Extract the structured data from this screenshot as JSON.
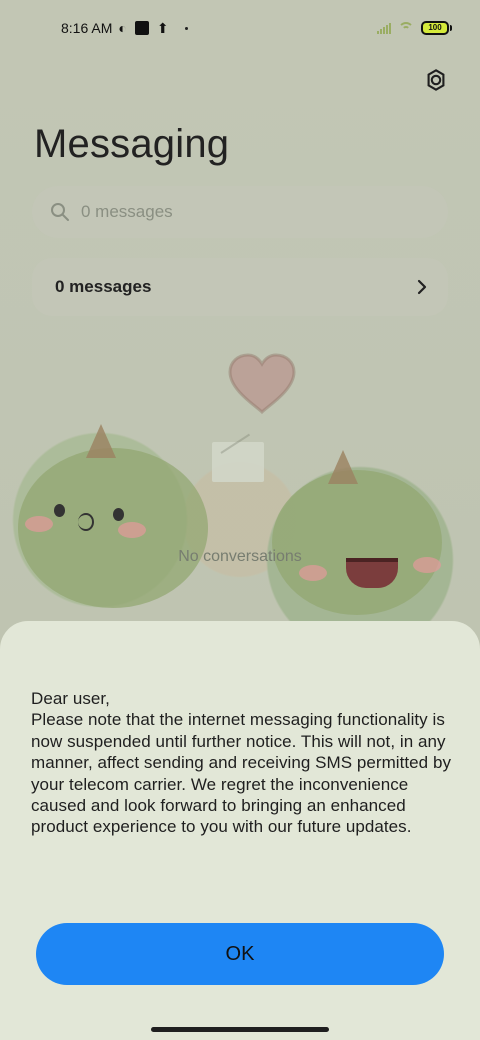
{
  "status_bar": {
    "time": "8:16 AM",
    "battery": "100"
  },
  "header": {
    "title": "Messaging"
  },
  "search": {
    "placeholder": "0 messages"
  },
  "messages_row": {
    "label": "0 messages"
  },
  "empty_state": {
    "text": "No conversations"
  },
  "dialog": {
    "message": "Dear user,\nPlease note that the internet messaging functionality is now suspended until further notice. This will not, in any manner, affect sending and receiving SMS permitted by your telecom carrier. We regret the inconvenience caused and look forward to bringing an enhanced product experience to you with our future updates.",
    "ok_label": "OK"
  },
  "colors": {
    "accent": "#1e86f4",
    "sheet": "#e2e7d7",
    "background": "#c9cfba"
  },
  "icons": {
    "settings": "gear-icon",
    "search": "search-icon",
    "chevron": "chevron-right-icon"
  }
}
